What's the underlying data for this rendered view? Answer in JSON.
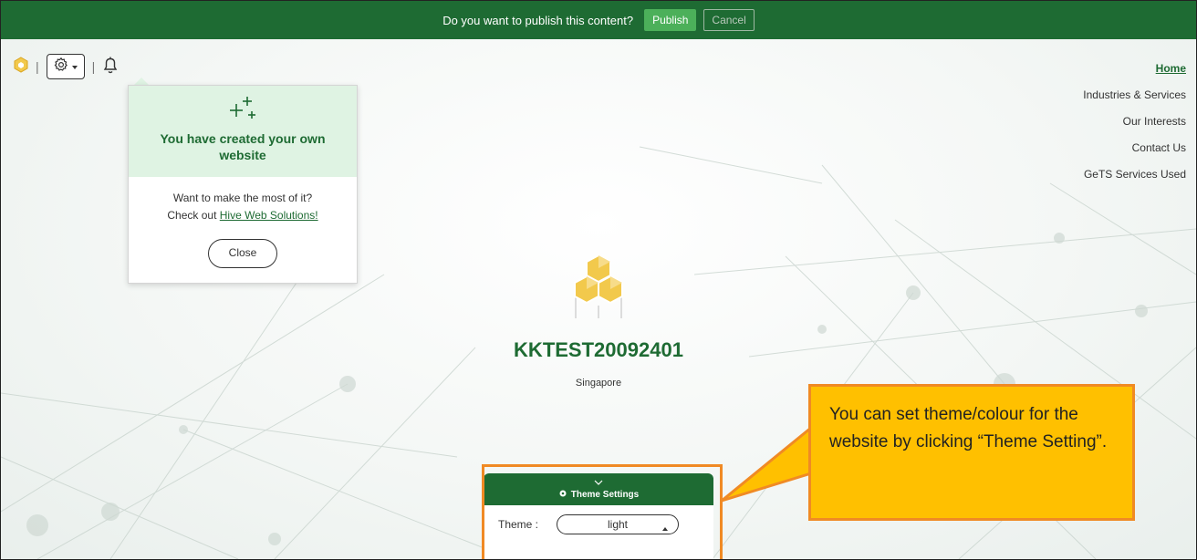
{
  "publish_bar": {
    "question": "Do you want to publish this content?",
    "publish_label": "Publish",
    "cancel_label": "Cancel"
  },
  "toolbar": {
    "separator": "|"
  },
  "notification": {
    "title": "You have created your own website",
    "line1": "Want to make the most of it?",
    "line2_prefix": "Check out ",
    "link_text": "Hive Web Solutions!",
    "close_label": "Close"
  },
  "nav": {
    "items": [
      "Home",
      "Industries & Services",
      "Our Interests",
      "Contact Us",
      "GeTS Services Used"
    ]
  },
  "site": {
    "name": "KKTEST20092401",
    "location": "Singapore"
  },
  "theme_settings": {
    "header": "Theme Settings",
    "theme_label": "Theme :",
    "theme_value": "light"
  },
  "callout": {
    "text": "You can set theme/colour for the website by clicking “Theme Setting”."
  },
  "colors": {
    "brand_green": "#1e6b33",
    "publish_green": "#4cb05a",
    "callout_fill": "#ffc000",
    "callout_border": "#f08a24",
    "logo_yellow": "#f2c94c"
  }
}
